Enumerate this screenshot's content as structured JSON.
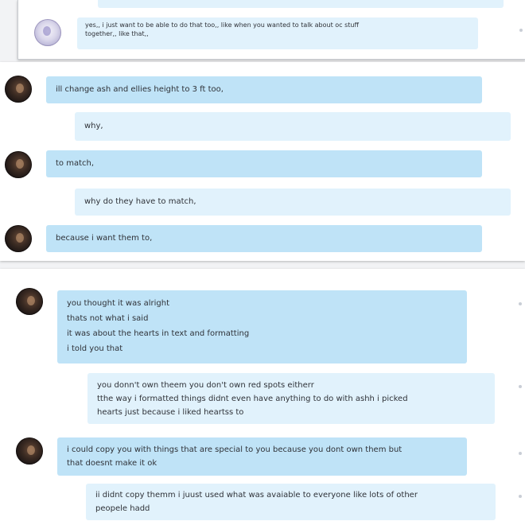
{
  "panel_top": {
    "message": {
      "lines": [
        "yes,, i just want to be able to do that too,, like when you wanted to talk about oc stuff",
        "together,, like that,,"
      ]
    }
  },
  "panel_middle": {
    "messages": [
      {
        "text": "ill change ash and ellies height to 3 ft too,"
      },
      {
        "text": "why,"
      },
      {
        "text": "to match,"
      },
      {
        "text": "why do they have to match,"
      },
      {
        "text": "because i want them to,"
      }
    ]
  },
  "panel_bottom": {
    "messages": [
      {
        "lines": [
          "you thought it was alright",
          "thats not what i said",
          "it was about the hearts in text and formatting",
          "i told you that"
        ]
      },
      {
        "lines": [
          "you donn't own theem you don't own red spots eitherr",
          "tthe way i formatted things didnt even have anything to do with ashh i picked",
          "hearts just because i liked heartss to"
        ]
      },
      {
        "lines": [
          "i could copy you with things that are special to you because you dont own them but",
          "that doesnt make it ok"
        ]
      },
      {
        "lines": [
          "ii didnt copy themm i juust used what was avaiable to everyone like lots of other",
          "peopele hadd"
        ]
      }
    ]
  },
  "colors": {
    "bubble_dark": "#bfe3f7",
    "bubble_light": "#e1f2fc",
    "background": "#f2f3f5"
  }
}
